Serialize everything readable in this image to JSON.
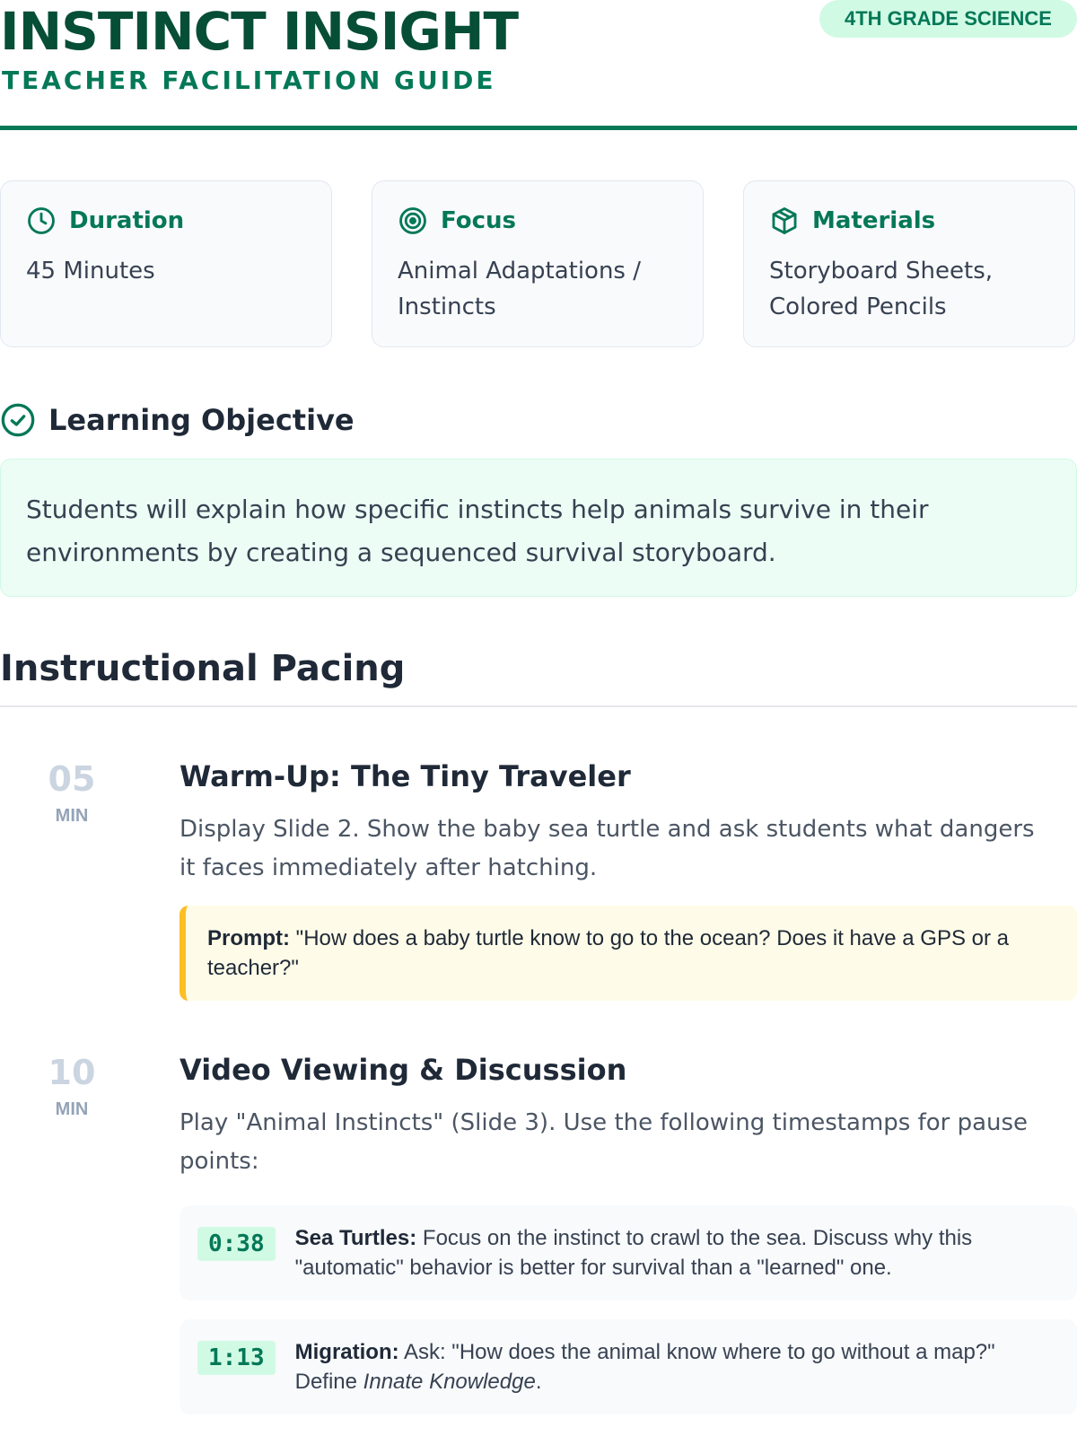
{
  "header": {
    "title": "INSTINCT INSIGHT",
    "subtitle": "TEACHER FACILITATION GUIDE",
    "badge": "4TH GRADE SCIENCE"
  },
  "cards": [
    {
      "icon": "clock-icon",
      "title": "Duration",
      "body": "45 Minutes"
    },
    {
      "icon": "target-icon",
      "title": "Focus",
      "body": "Animal Adaptations / Instincts"
    },
    {
      "icon": "box-icon",
      "title": "Materials",
      "body": "Storyboard Sheets, Colored Pencils"
    }
  ],
  "objective": {
    "icon": "check-circle-icon",
    "title": "Learning Objective",
    "text": "Students will explain how specific instincts help animals survive in their environments by creating a sequenced survival storyboard."
  },
  "pacing": {
    "title": "Instructional Pacing",
    "steps": [
      {
        "minutes": "05",
        "unit": "MIN",
        "title": "Warm-Up: The Tiny Traveler",
        "description": "Display Slide 2. Show the baby sea turtle and ask students what dangers it faces immediately after hatching.",
        "prompt_label": "Prompt:",
        "prompt_text": " \"How does a baby turtle know to go to the ocean? Does it have a GPS or a teacher?\""
      },
      {
        "minutes": "10",
        "unit": "MIN",
        "title": "Video Viewing & Discussion",
        "description": "Play \"Animal Instincts\" (Slide 3). Use the following timestamps for pause points:",
        "timestamps": [
          {
            "time": "0:38",
            "label": "Sea Turtles:",
            "text": " Focus on the instinct to crawl to the sea. Discuss why this \"automatic\" behavior is better for survival than a \"learned\" one.",
            "emphasis": ""
          },
          {
            "time": "1:13",
            "label": "Migration:",
            "text": " Ask: \"How does the animal know where to go without a map?\" Define ",
            "emphasis": "Innate Knowledge",
            "after": "."
          }
        ]
      }
    ]
  },
  "colors": {
    "brand_dark": "#064e36",
    "accent": "#047857",
    "badge_bg": "#d1fae5",
    "objective_bg": "#ecfdf5",
    "prompt_bg": "#fefce8",
    "prompt_border": "#fbbf24"
  }
}
